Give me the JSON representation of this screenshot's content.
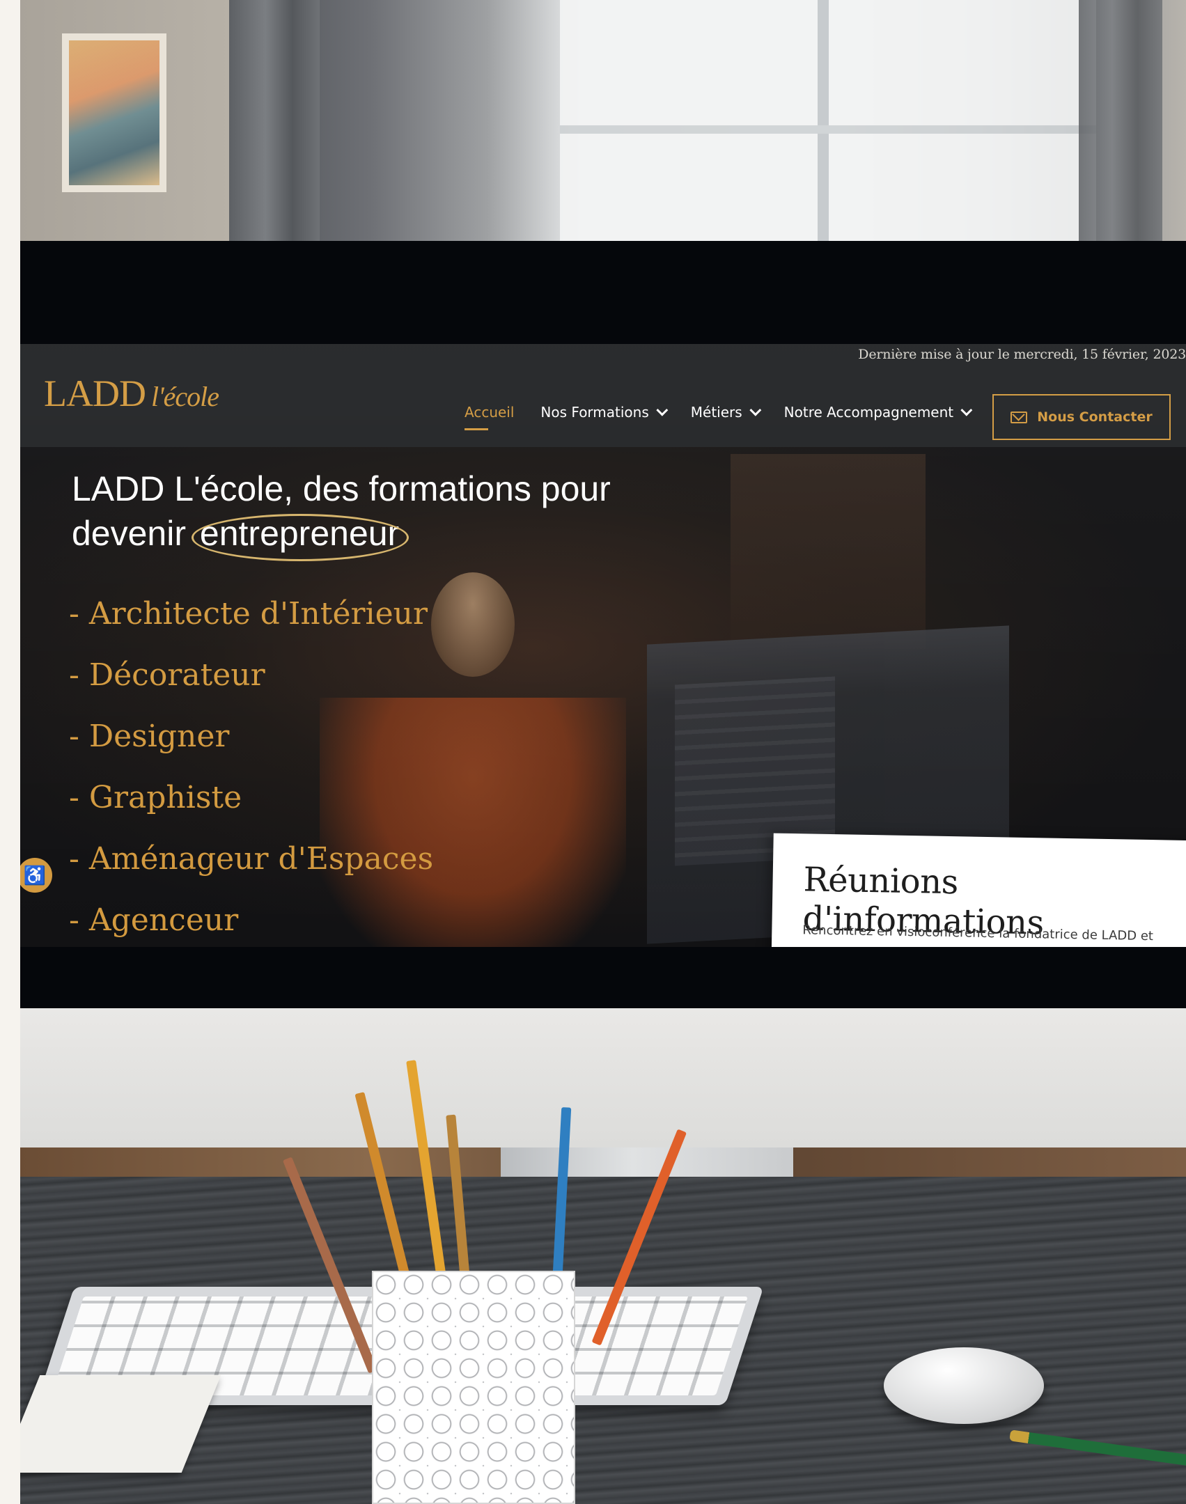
{
  "site": {
    "update_line": "Dernière mise à jour le mercredi, 15 février, 2023",
    "logo_main": "LADD",
    "logo_script": "l'école"
  },
  "nav": {
    "items": [
      {
        "label": "Accueil",
        "active": true,
        "has_dropdown": false
      },
      {
        "label": "Nos Formations",
        "active": false,
        "has_dropdown": true
      },
      {
        "label": "Métiers",
        "active": false,
        "has_dropdown": true
      },
      {
        "label": "Notre Accompagnement",
        "active": false,
        "has_dropdown": true
      }
    ],
    "cta_label": "Nous Contacter",
    "cta_icon": "mail-icon"
  },
  "hero": {
    "title_part1": "LADD L'école, des formations pour devenir",
    "title_highlight": "entrepreneur",
    "metiers": [
      "- Architecte d'Intérieur",
      "- Décorateur",
      "- Designer",
      "- Graphiste",
      "- Aménageur d'Espaces",
      "- Agenceur"
    ]
  },
  "info_card": {
    "title": "Réunions d'informations",
    "text": "Rencontrez en visioconférence la fondatrice de LADD et"
  },
  "accessibility": {
    "icon": "accessibility-icon"
  },
  "colors": {
    "accent": "#d39a3f",
    "header_bg": "#222426",
    "text_light": "#ffffff"
  }
}
